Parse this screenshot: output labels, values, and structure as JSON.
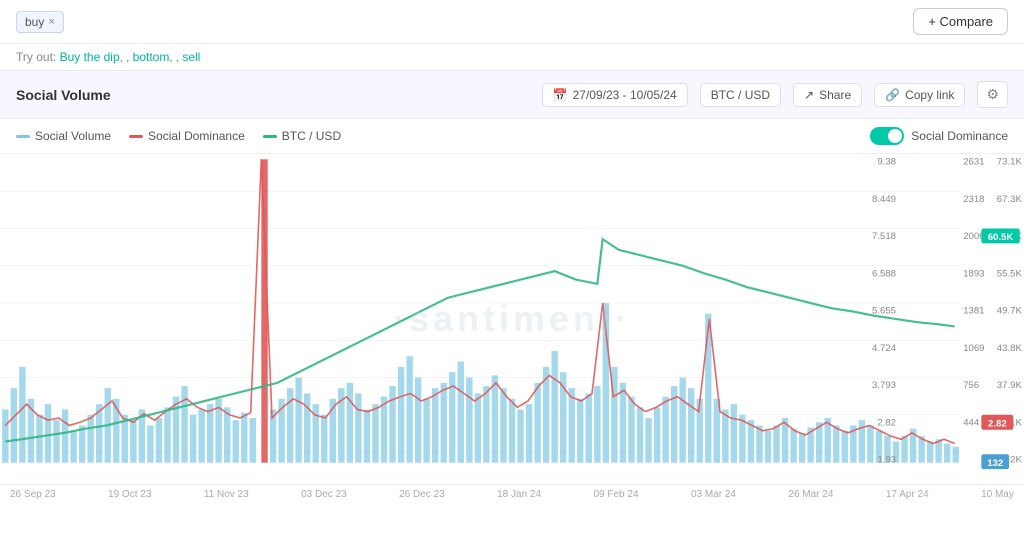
{
  "top_bar": {
    "tag": "buy",
    "close_label": "×",
    "compare_label": "+ Compare"
  },
  "try_out": {
    "prefix": "Try out:",
    "links": [
      "Buy the dip",
      "bottom",
      "sell"
    ]
  },
  "chart_header": {
    "title": "Social Volume",
    "date_range": "27/09/23 - 10/05/24",
    "pair": "BTC / USD",
    "share_label": "Share",
    "copy_label": "Copy link",
    "settings_icon": "⚙"
  },
  "legend": {
    "items": [
      {
        "label": "Social Volume",
        "color": "#7ec8e3"
      },
      {
        "label": "Social Dominance",
        "color": "#e05858"
      },
      {
        "label": "BTC / USD",
        "color": "#2db87d"
      }
    ],
    "toggle_label": "Social Dominance"
  },
  "y_axis_left": {
    "labels": [
      "2631",
      "2318",
      "2006",
      "1893",
      "1381",
      "1069",
      "756",
      "444",
      ""
    ]
  },
  "y_axis_mid": {
    "labels": [
      "9.38",
      "8.449",
      "7.518",
      "6.588",
      "5.655",
      "4.724",
      "3.793",
      "2.82",
      "1.93"
    ]
  },
  "y_axis_right": {
    "labels": [
      "73.1K",
      "67.3K",
      "60.5K",
      "55.5K",
      "49.7K",
      "43.8K",
      "37.9K",
      "32.1K",
      "26.2K"
    ]
  },
  "x_axis": {
    "labels": [
      "26 Sep 23",
      "19 Oct 23",
      "11 Nov 23",
      "03 Dec 23",
      "26 Dec 23",
      "18 Jan 24",
      "09 Feb 24",
      "03 Mar 24",
      "26 Mar 24",
      "17 Apr 24",
      "10 May"
    ]
  },
  "badges": {
    "green": "60.5K",
    "red": "2.82",
    "blue": "132"
  },
  "watermark": "·santiment·"
}
